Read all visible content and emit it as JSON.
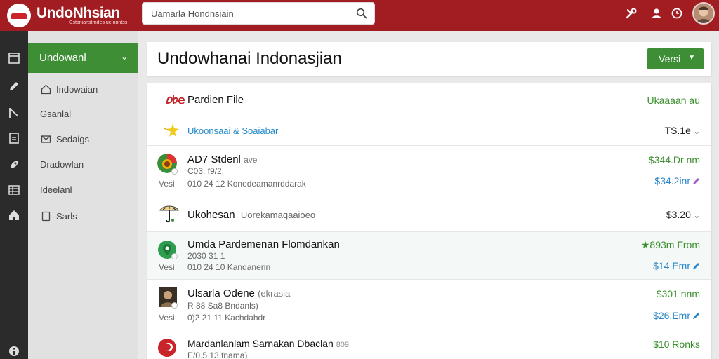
{
  "header": {
    "logo_text": "UndoNhsian",
    "logo_subtext": "Gstanianstrndes ue nnntss",
    "search": {
      "placeholder": "Uamarla Hondnsiain",
      "value": ""
    },
    "icons": [
      "tools-icon",
      "user-icon",
      "clock-icon"
    ]
  },
  "rail": {
    "icons": [
      "window-icon",
      "pencil-icon",
      "flag-icon",
      "document-icon",
      "rocket-icon",
      "table-icon",
      "home-icon",
      "info-icon"
    ]
  },
  "sidebar": {
    "header_label": "Undowanl",
    "items": [
      {
        "label": "Indowaian",
        "icon": "home-outline-icon"
      },
      {
        "label": "Gsanlal",
        "icon": ""
      },
      {
        "label": "Sedaigs",
        "icon": "mail-icon"
      },
      {
        "label": "Dradowlan",
        "icon": ""
      },
      {
        "label": "Ideelanl",
        "icon": ""
      },
      {
        "label": "Sarls",
        "icon": "page-icon"
      }
    ]
  },
  "main": {
    "title": "Undowhanai Indonasjian",
    "versi_button": "Versi"
  },
  "list": {
    "header": {
      "title": "Pardien File",
      "right": "Ukaaaan au"
    },
    "rows": [
      {
        "type": "link",
        "text": "Ukoonsaai & Soaiabar",
        "right": "TS.1e"
      },
      {
        "type": "item",
        "title": "AD7 Stdenl",
        "title_sub": "ave",
        "meta1": "C03. f9/2.",
        "versi": "Vesi",
        "meta2": "010 24 12  Konedeamanrddarak",
        "price1": "$344.Dr nm",
        "price2": "$34.2inr"
      },
      {
        "type": "simple",
        "title": "Ukohesan",
        "title_sub": "Uorekamaqaaioeo",
        "right": "$3.20"
      },
      {
        "type": "item",
        "title": "Umda Pardemenan Flomdankan",
        "title_sub": "",
        "meta1": "2030 31 1",
        "versi": "Vesi",
        "meta2": "010 24 10  Kandanenn",
        "price1": "★893m From",
        "price2": "$14 Emr"
      },
      {
        "type": "item",
        "title": "Ulsarla Odene",
        "title_sub": "(ekrasia",
        "meta1": "R 88 Sa8 Bndanls)",
        "versi": "Vesi",
        "meta2": "0)2 21 11  Kachdahdr",
        "price1": "$301 nnm",
        "price2": "$26.Emr"
      },
      {
        "type": "partial",
        "title": "Mardanlanlam Sarnakan Dbaclan",
        "title_sub": "809",
        "meta1": "E/0.5 13  fnama)",
        "price1": "$10 Ronks"
      }
    ]
  },
  "colors": {
    "brand_red": "#a11d21",
    "accent_green": "#3e8e35",
    "link_blue": "#1e88c9",
    "rail_dark": "#2b2b2b"
  }
}
